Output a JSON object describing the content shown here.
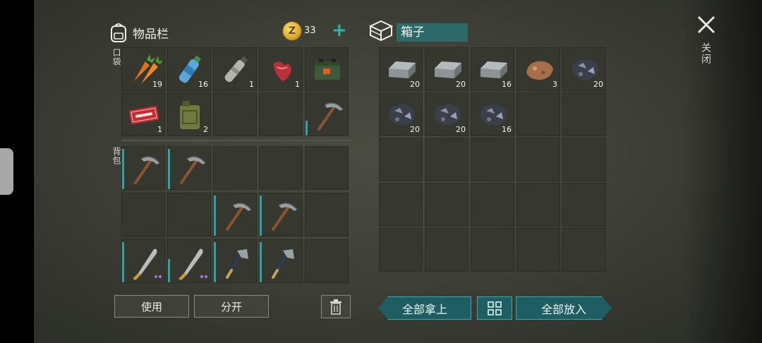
{
  "inventory": {
    "title": "物品栏",
    "coins": "33",
    "coin_symbol": "Z",
    "add_label": "+",
    "pocket_label": "口袋",
    "backpack_label": "背包",
    "pocket_slots": [
      {
        "item": "carrot",
        "count": "19"
      },
      {
        "item": "water-bottle",
        "count": "16"
      },
      {
        "item": "empty-bottle",
        "count": "1"
      },
      {
        "item": "raw-meat",
        "count": "1"
      },
      {
        "item": "battery-pack",
        "count": ""
      },
      {
        "item": "coupon",
        "count": "1"
      },
      {
        "item": "jerrycan",
        "count": "2"
      },
      {
        "item": "",
        "count": ""
      },
      {
        "item": "",
        "count": ""
      },
      {
        "item": "pickaxe",
        "count": "",
        "durability": 0.35
      }
    ],
    "backpack_slots": [
      {
        "item": "pickaxe",
        "count": "",
        "durability": 0.95
      },
      {
        "item": "pickaxe",
        "count": "",
        "durability": 0.95
      },
      {
        "item": "",
        "count": ""
      },
      {
        "item": "",
        "count": ""
      },
      {
        "item": "",
        "count": ""
      },
      {
        "item": "",
        "count": ""
      },
      {
        "item": "",
        "count": ""
      },
      {
        "item": "pickaxe",
        "count": "",
        "durability": 0.95
      },
      {
        "item": "pickaxe",
        "count": "",
        "durability": 0.95
      },
      {
        "item": "",
        "count": ""
      },
      {
        "item": "machete",
        "count": "",
        "durability": 0.95,
        "rarity_dots": 2
      },
      {
        "item": "machete",
        "count": "",
        "durability": 0.55,
        "rarity_dots": 2
      },
      {
        "item": "hatchet",
        "count": "",
        "durability": 0.95
      },
      {
        "item": "hatchet",
        "count": "",
        "durability": 0.95
      },
      {
        "item": "",
        "count": ""
      }
    ],
    "use_label": "使用",
    "split_label": "分开"
  },
  "box": {
    "title": "箱子",
    "slots": [
      {
        "item": "iron-bar",
        "count": "20"
      },
      {
        "item": "iron-bar",
        "count": "20"
      },
      {
        "item": "iron-bar",
        "count": "16"
      },
      {
        "item": "copper-ore",
        "count": "3"
      },
      {
        "item": "iron-ore",
        "count": "20"
      },
      {
        "item": "iron-ore",
        "count": "20"
      },
      {
        "item": "iron-ore",
        "count": "20"
      },
      {
        "item": "iron-ore",
        "count": "16"
      }
    ],
    "take_all_label": "全部拿上",
    "put_all_label": "全部放入"
  },
  "close_label": "关闭",
  "colors": {
    "accent": "#2bb7a7",
    "durability": "#2fa4a6",
    "rarity": "#a973e0"
  }
}
